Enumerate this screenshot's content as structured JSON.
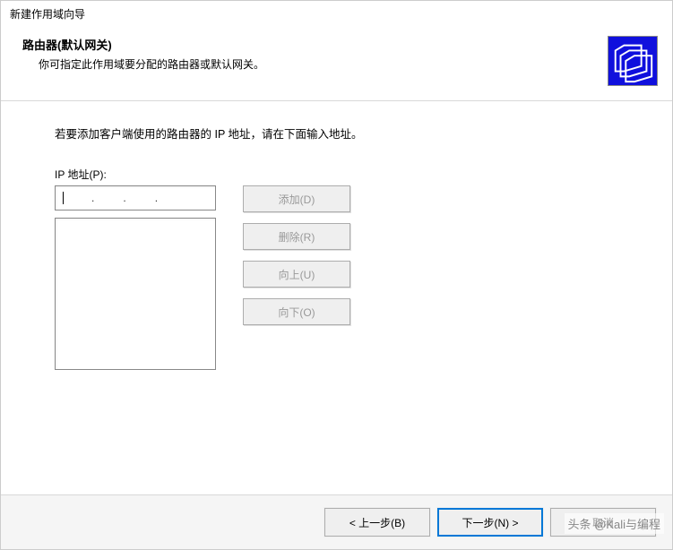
{
  "window": {
    "title": "新建作用域向导"
  },
  "header": {
    "title": "路由器(默认网关)",
    "description": "你可指定此作用域要分配的路由器或默认网关。",
    "icon_name": "folders-icon"
  },
  "main": {
    "instruction": "若要添加客户端使用的路由器的 IP 地址，请在下面输入地址。",
    "ip_label": "IP 地址(P):",
    "ip_value": "",
    "list_items": []
  },
  "side_buttons": {
    "add": "添加(D)",
    "remove": "删除(R)",
    "up": "向上(U)",
    "down": "向下(O)"
  },
  "footer": {
    "back": "< 上一步(B)",
    "next": "下一步(N) >",
    "cancel": "取消"
  },
  "watermark": "头条 @Kali与编程"
}
